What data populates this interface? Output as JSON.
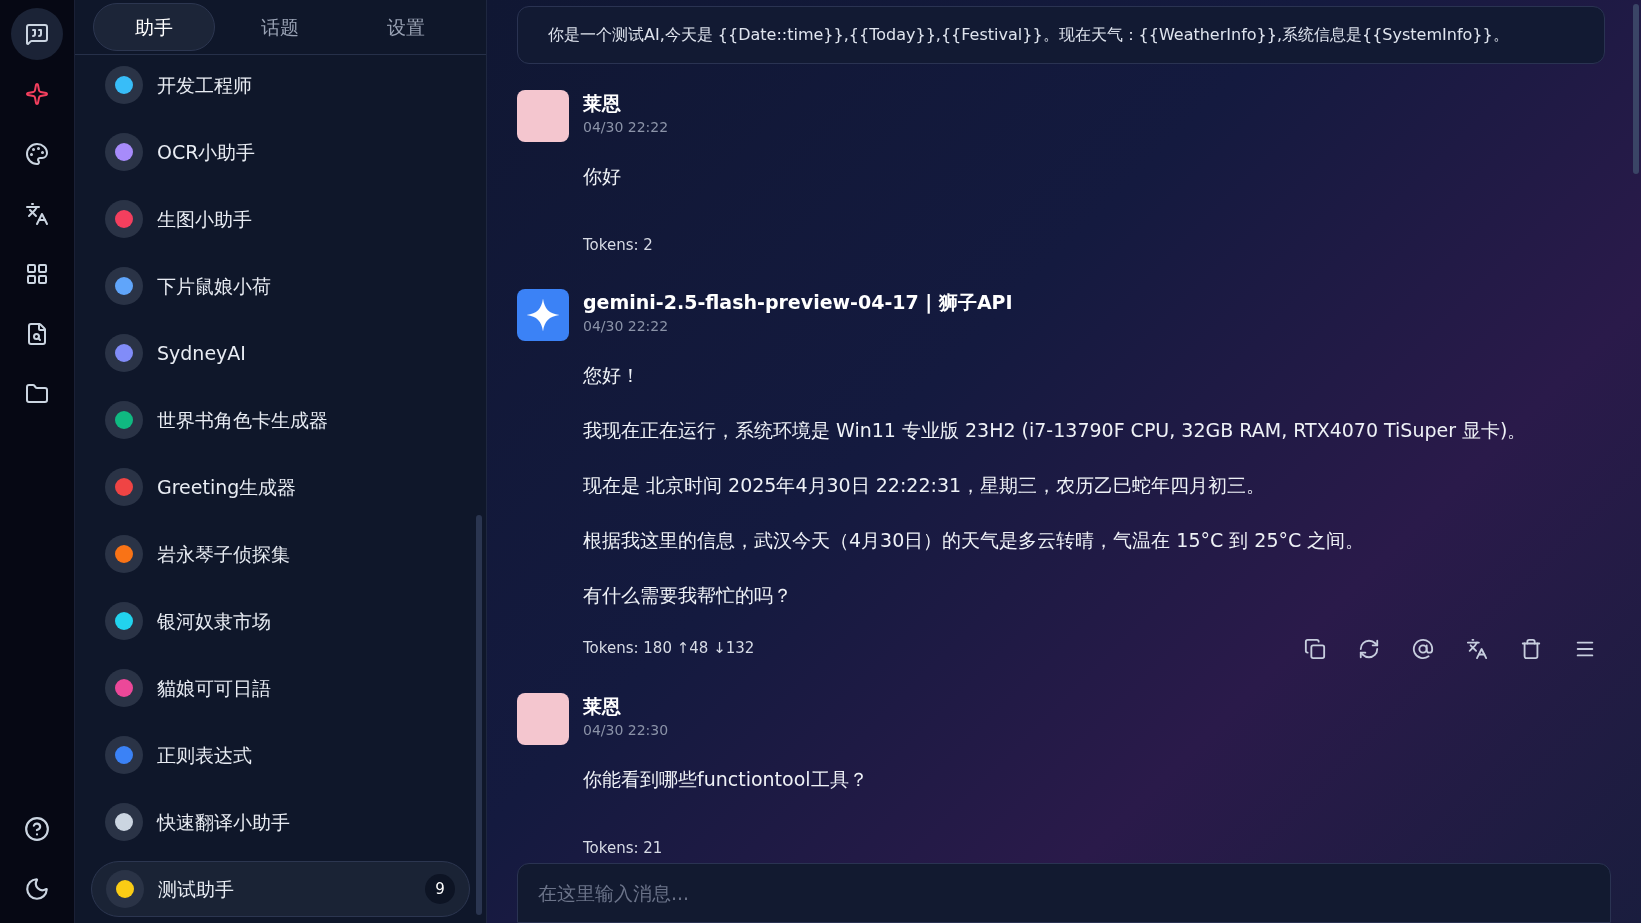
{
  "rail": {
    "items": [
      {
        "selected": true
      },
      {
        "selected": false
      },
      {
        "selected": false
      },
      {
        "selected": false
      },
      {
        "selected": false
      },
      {
        "selected": false
      },
      {
        "selected": false
      }
    ]
  },
  "tabs": [
    {
      "label": "助手",
      "selected": true
    },
    {
      "label": "话题",
      "selected": false
    },
    {
      "label": "设置",
      "selected": false
    }
  ],
  "assistants": [
    {
      "name": "开发工程师",
      "color": "#38bdf8",
      "selected": false
    },
    {
      "name": "OCR小助手",
      "color": "#a78bfa",
      "selected": false
    },
    {
      "name": "生图小助手",
      "color": "#f43f5e",
      "selected": false
    },
    {
      "name": "下片鼠娘小荷",
      "color": "#60a5fa",
      "selected": false
    },
    {
      "name": "SydneyAI",
      "color": "#818cf8",
      "selected": false
    },
    {
      "name": "世界书角色卡生成器",
      "color": "#10b981",
      "selected": false
    },
    {
      "name": "Greeting生成器",
      "color": "#ef4444",
      "selected": false
    },
    {
      "name": "岩永琴子侦探集",
      "color": "#f97316",
      "selected": false
    },
    {
      "name": "银河奴隶市场",
      "color": "#22d3ee",
      "selected": false
    },
    {
      "name": "貓娘可可日語",
      "color": "#ec4899",
      "selected": false
    },
    {
      "name": "正则表达式",
      "color": "#3b82f6",
      "selected": false
    },
    {
      "name": "快速翻译小助手",
      "color": "#cbd5e1",
      "selected": false
    },
    {
      "name": "测试助手",
      "color": "#facc15",
      "selected": true,
      "badge": "9"
    }
  ],
  "system_prompt": "你是一个测试AI,今天是 {{Date::time}},{{Today}},{{Festival}}。现在天气：{{WeatherInfo}},系统信息是{{SystemInfo}}。",
  "messages": [
    {
      "kind": "user",
      "author": "莱恩",
      "time": "04/30 22:22",
      "paragraphs": [
        "你好"
      ],
      "tokens": "Tokens: 2",
      "actions": false
    },
    {
      "kind": "model",
      "author": "gemini-2.5-flash-preview-04-17 | 狮子API",
      "time": "04/30 22:22",
      "paragraphs": [
        "您好！",
        "我现在正在运行，系统环境是 Win11 专业版 23H2 (i7-13790F CPU, 32GB RAM, RTX4070 TiSuper 显卡)。",
        "现在是 北京时间 2025年4月30日 22:22:31，星期三，农历乙巳蛇年四月初三。",
        "根据我这里的信息，武汉今天（4月30日）的天气是多云转晴，气温在 15°C 到 25°C 之间。",
        "有什么需要我帮忙的吗？"
      ],
      "tokens": "Tokens: 180 ↑48 ↓132",
      "actions": true
    },
    {
      "kind": "user",
      "author": "莱恩",
      "time": "04/30 22:30",
      "paragraphs": [
        "你能看到哪些functiontool工具？"
      ],
      "tokens": "Tokens: 21",
      "actions": false
    }
  ],
  "input": {
    "placeholder": "在这里输入消息..."
  }
}
